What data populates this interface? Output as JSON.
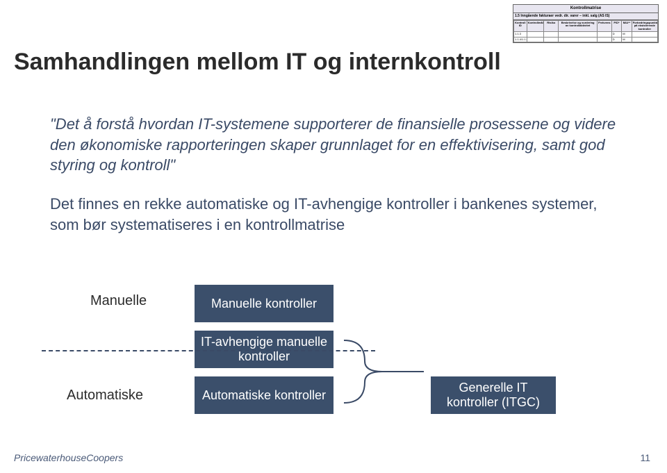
{
  "title": "Samhandlingen mellom IT og internkontroll",
  "quote": "\"Det å forstå hvordan IT-systemene supporterer de finansielle prosessene og videre den økonomiske rapporteringen skaper grunnlaget for en effektivisering, samt god styring og kontroll\"",
  "para": "Det finnes en rekke automatiske og IT-avhengige kontroller i bankenes systemer, som bør systematiseres i en kontrollmatrise",
  "diagram": {
    "label_manual": "Manuelle",
    "label_auto": "Automatiske",
    "box_manual": "Manuelle kontroller",
    "box_itdep": "IT-avhengige manuelle kontroller",
    "box_auto": "Automatiske kontroller",
    "box_itgc": "Generelle IT kontroller (ITGC)"
  },
  "matrix": {
    "title": "Kontrollmatrise",
    "subtitle": "1.5 Inngående fakturaer vedr. dir. varer – inkl. salg (AS IS)",
    "headers": [
      "Kontroll ID",
      "Kontrollmål",
      "Risiko",
      "Beskrivelse og vurdering av kontrollaktivitet",
      "Frekvens",
      "P/D*",
      "M/A**",
      "Forbedringspunkter på eksisterende kontroller"
    ],
    "rows": [
      [
        "1.1.3",
        "",
        "",
        "",
        "",
        "D",
        "M",
        ""
      ],
      [
        "1.1.4/1.1.x",
        "",
        "",
        "",
        "",
        "D",
        "M",
        ""
      ]
    ]
  },
  "footer": {
    "brand": "PricewaterhouseCoopers",
    "page": "11"
  }
}
